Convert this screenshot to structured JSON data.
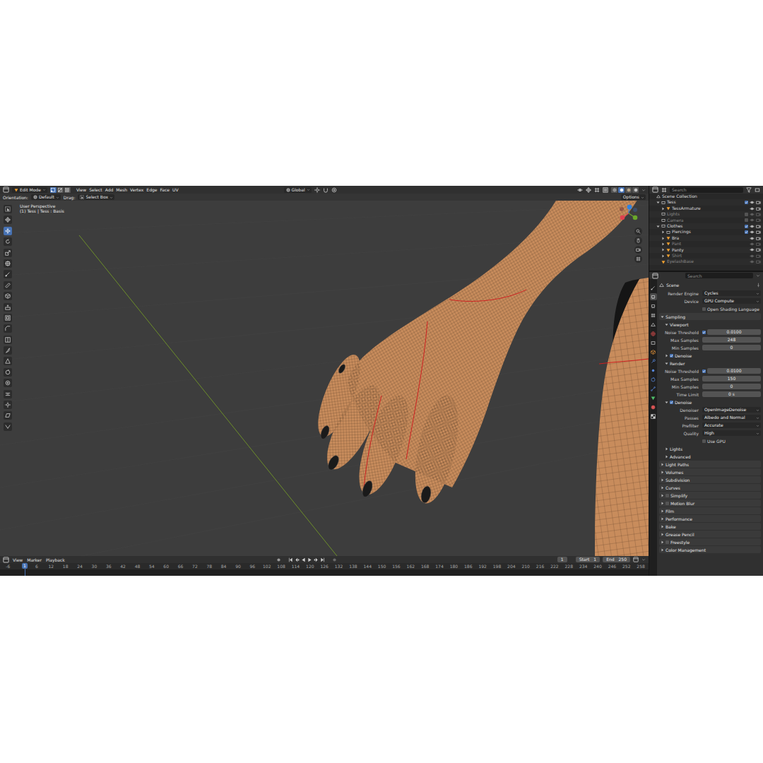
{
  "viewport": {
    "header": {
      "editor_mode": "Edit Mode",
      "select_modes": [
        {
          "selected": true
        },
        {
          "selected": false
        },
        {
          "selected": false
        }
      ],
      "menus": [
        "View",
        "Select",
        "Add",
        "Mesh",
        "Vertex",
        "Edge",
        "Face",
        "UV"
      ],
      "orientation": "Global",
      "shading_modes": [
        {
          "selected": false
        },
        {
          "selected": true
        },
        {
          "selected": false
        },
        {
          "selected": false
        }
      ]
    },
    "tool_settings": {
      "orientation_label": "Orientation:",
      "orientation": "Default",
      "drag_label": "Drag:",
      "drag": "Select Box",
      "options": "Options"
    },
    "overlay": {
      "view_name": "User Perspective",
      "object_info": "(1) Tess | Tess : Basis"
    },
    "tools": [
      {
        "selected": false
      },
      {
        "selected": false
      },
      {
        "selected": true
      },
      {
        "selected": false
      },
      {
        "selected": false
      },
      {
        "selected": false
      },
      {
        "selected": false
      },
      {
        "selected": false
      },
      {
        "selected": false
      },
      {
        "selected": false
      },
      {
        "selected": false
      },
      {
        "selected": false
      },
      {
        "selected": false
      },
      {
        "selected": false
      },
      {
        "selected": false
      },
      {
        "selected": false
      },
      {
        "selected": false
      },
      {
        "selected": false
      },
      {
        "selected": false
      },
      {
        "selected": false
      },
      {
        "selected": false
      }
    ]
  },
  "timeline": {
    "menus": [
      "View",
      "Marker",
      "Playback"
    ],
    "current_frame": "1",
    "start_label": "Start",
    "start": "1",
    "end_label": "End",
    "end": "250",
    "playhead": "1",
    "ruler": [
      "-6",
      "6",
      "12",
      "18",
      "24",
      "30",
      "36",
      "42",
      "48",
      "54",
      "60",
      "66",
      "72",
      "78",
      "84",
      "90",
      "96",
      "102",
      "108",
      "114",
      "120",
      "126",
      "132",
      "138",
      "144",
      "150",
      "156",
      "162",
      "168",
      "174",
      "180",
      "186",
      "192",
      "198",
      "204",
      "210",
      "216",
      "222",
      "228",
      "234",
      "240",
      "246",
      "252",
      "258"
    ]
  },
  "outliner": {
    "search_placeholder": "Search",
    "items": [
      {
        "label": "Scene Collection",
        "depth": 0,
        "kind": "scene",
        "dimmed": false
      },
      {
        "label": "Tess",
        "depth": 1,
        "kind": "collection",
        "expanded": true,
        "checked": true,
        "dimmed": false
      },
      {
        "label": "TessArmature",
        "depth": 2,
        "kind": "object",
        "expanded": false,
        "dimmed": false
      },
      {
        "label": "Lights",
        "depth": 1,
        "kind": "collection",
        "checked": false,
        "dimmed": true
      },
      {
        "label": "Camera",
        "depth": 1,
        "kind": "collection",
        "checked": false,
        "dimmed": true
      },
      {
        "label": "Clothes",
        "depth": 1,
        "kind": "collection",
        "expanded": true,
        "checked": true,
        "dimmed": false
      },
      {
        "label": "Piercings",
        "depth": 2,
        "kind": "collection",
        "expanded": false,
        "checked": true,
        "dimmed": false
      },
      {
        "label": "Bra",
        "depth": 2,
        "kind": "object",
        "expanded": false,
        "dimmed": false
      },
      {
        "label": "Pant",
        "depth": 2,
        "kind": "object",
        "expanded": false,
        "dimmed": true
      },
      {
        "label": "Panty",
        "depth": 2,
        "kind": "object",
        "expanded": false,
        "dimmed": false
      },
      {
        "label": "Shirt",
        "depth": 2,
        "kind": "object",
        "expanded": false,
        "dimmed": true
      },
      {
        "label": "EyelashBase",
        "depth": 1,
        "kind": "object",
        "dimmed": true
      }
    ]
  },
  "properties": {
    "search_placeholder": "Search",
    "breadcrumb": "Scene",
    "tabs": [
      {
        "selected": false,
        "color": "#c8c8c8"
      },
      {
        "selected": true,
        "color": "#e0e0e0"
      },
      {
        "selected": false,
        "color": "#d8d8d8"
      },
      {
        "selected": false,
        "color": "#d8d8d8"
      },
      {
        "selected": false,
        "color": "#d8d8d8"
      },
      {
        "selected": false,
        "color": "#d04a4a"
      },
      {
        "selected": false,
        "color": "#d8d8d8"
      },
      {
        "selected": false,
        "color": "#e8963a"
      },
      {
        "selected": false,
        "color": "#5b8ee6"
      },
      {
        "selected": false,
        "color": "#5b8ee6"
      },
      {
        "selected": false,
        "color": "#5b8ee6"
      },
      {
        "selected": false,
        "color": "#5b8ee6"
      },
      {
        "selected": false,
        "color": "#4fbf6a"
      },
      {
        "selected": false,
        "color": "#d95454"
      },
      {
        "selected": false,
        "color": "#c8c8c8"
      }
    ],
    "rows": [
      {
        "kind": "dropdown",
        "label": "Render Engine",
        "value": "Cycles"
      },
      {
        "kind": "dropdown",
        "label": "Device",
        "value": "GPU Compute"
      },
      {
        "kind": "checkbox",
        "label": "Open Shading Language",
        "checked": false
      },
      {
        "kind": "panel",
        "label": "Sampling",
        "depth": 0,
        "expanded": true
      },
      {
        "kind": "panel",
        "label": "Viewport",
        "depth": 1,
        "expanded": true
      },
      {
        "kind": "number",
        "label": "Noise Threshold",
        "value": "0.0100",
        "checked": true
      },
      {
        "kind": "number",
        "label": "Max Samples",
        "value": "248"
      },
      {
        "kind": "number",
        "label": "Min Samples",
        "value": "0"
      },
      {
        "kind": "panel",
        "label": "Denoise",
        "depth": 1,
        "expanded": false,
        "checked": true
      },
      {
        "kind": "panel",
        "label": "Render",
        "depth": 1,
        "expanded": true
      },
      {
        "kind": "number",
        "label": "Noise Threshold",
        "value": "0.0100",
        "checked": true
      },
      {
        "kind": "number",
        "label": "Max Samples",
        "value": "150"
      },
      {
        "kind": "number",
        "label": "Min Samples",
        "value": "0"
      },
      {
        "kind": "number",
        "label": "Time Limit",
        "value": "0 s"
      },
      {
        "kind": "panel",
        "label": "Denoise",
        "depth": 1,
        "expanded": true,
        "checked": true
      },
      {
        "kind": "dropdown",
        "label": "Denoiser",
        "value": "OpenImageDenoise"
      },
      {
        "kind": "dropdown",
        "label": "Passes",
        "value": "Albedo and Normal"
      },
      {
        "kind": "dropdown",
        "label": "Prefilter",
        "value": "Accurate"
      },
      {
        "kind": "dropdown",
        "label": "Quality",
        "value": "High"
      },
      {
        "kind": "checkbox",
        "label": "Use GPU",
        "checked": false
      },
      {
        "kind": "panel",
        "label": "Lights",
        "depth": 1,
        "expanded": false
      },
      {
        "kind": "panel",
        "label": "Advanced",
        "depth": 1,
        "expanded": false
      },
      {
        "kind": "panel",
        "label": "Light Paths",
        "depth": 0,
        "expanded": false
      },
      {
        "kind": "panel",
        "label": "Volumes",
        "depth": 0,
        "expanded": false
      },
      {
        "kind": "panel",
        "label": "Subdivision",
        "depth": 0,
        "expanded": false
      },
      {
        "kind": "panel",
        "label": "Curves",
        "depth": 0,
        "expanded": false
      },
      {
        "kind": "panel",
        "label": "Simplify",
        "depth": 0,
        "expanded": false,
        "checked": false
      },
      {
        "kind": "panel",
        "label": "Motion Blur",
        "depth": 0,
        "expanded": false,
        "checked": false
      },
      {
        "kind": "panel",
        "label": "Film",
        "depth": 0,
        "expanded": false
      },
      {
        "kind": "panel",
        "label": "Performance",
        "depth": 0,
        "expanded": false
      },
      {
        "kind": "panel",
        "label": "Bake",
        "depth": 0,
        "expanded": false
      },
      {
        "kind": "panel",
        "label": "Grease Pencil",
        "depth": 0,
        "expanded": false
      },
      {
        "kind": "panel",
        "label": "Freestyle",
        "depth": 0,
        "expanded": false,
        "checked": false
      },
      {
        "kind": "panel",
        "label": "Color Management",
        "depth": 0,
        "expanded": false
      }
    ]
  }
}
